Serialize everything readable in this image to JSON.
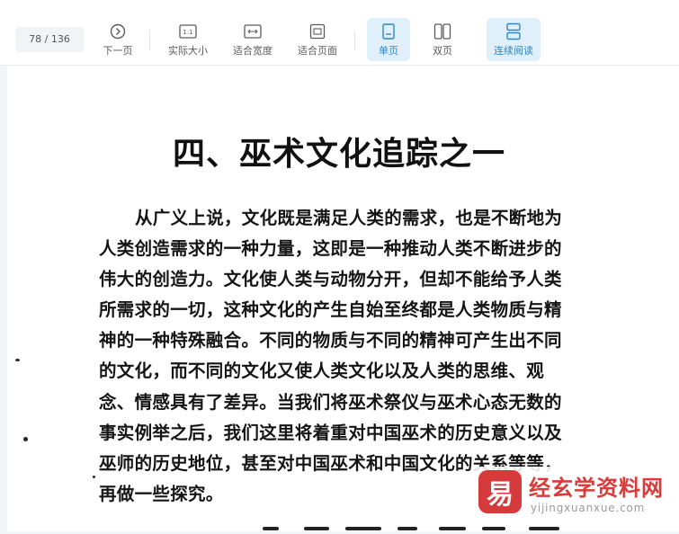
{
  "toolbar": {
    "page_indicator": "78 / 136",
    "buttons": {
      "next": "下一页",
      "actual_size": "实际大小",
      "fit_width": "适合宽度",
      "fit_page": "适合页面",
      "single_page": "单页",
      "double_page": "双页",
      "continuous": "连续阅读"
    },
    "actual_size_icon_text": "1:1",
    "active_color": "#2f86c6",
    "active_bg": "#dff0fb"
  },
  "document": {
    "heading": "四、巫术文化追踪之一",
    "paragraph_lines": [
      "从广义上说，文化既是满足人类的需求，也是不断地为",
      "人类创造需求的一种力量，这即是一种推动人类不断进步的",
      "伟大的创造力。文化使人类与动物分开，但却不能给予人类",
      "所需求的一切，这种文化的产生自始至终都是人类物质与精",
      "神的一种特殊融合。不同的物质与不同的精神可产生出不同",
      "的文化，而不同的文化又使人类文化以及人类的思维、观",
      "念、情感具有了差异。当我们将巫术祭仪与巫术心态无数的",
      "事实例举之后，我们这里将着重对中国巫术的历史意义以及",
      "巫师的历史地位，甚至对中国巫术和中国文化的关系等等，",
      "再做一些探究。"
    ]
  },
  "watermark": {
    "logo_char": "易",
    "title": "经玄学资料网",
    "url": "yijingxuanxue.com",
    "color": "#d93a3a"
  }
}
